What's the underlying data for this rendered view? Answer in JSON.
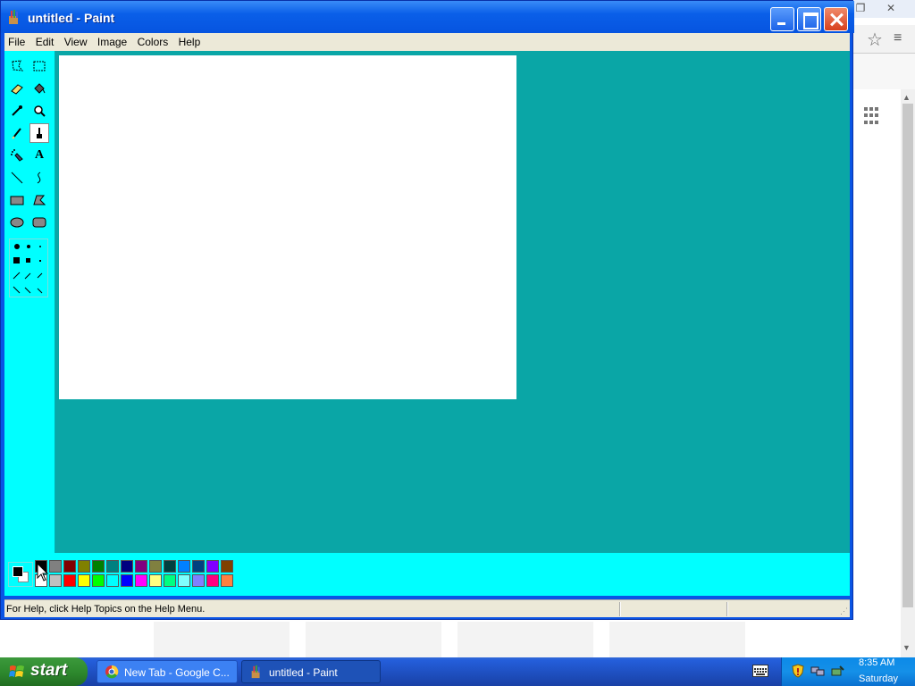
{
  "window": {
    "title": "untitled - Paint"
  },
  "menu": [
    "File",
    "Edit",
    "View",
    "Image",
    "Colors",
    "Help"
  ],
  "tools": [
    "free-form-select",
    "select",
    "eraser",
    "fill-with-color",
    "pick-color",
    "magnifier",
    "pencil",
    "brush",
    "airbrush",
    "text",
    "line",
    "curve",
    "rectangle",
    "polygon",
    "ellipse",
    "rounded-rectangle"
  ],
  "text_tool_glyph": "A",
  "palette": {
    "top": [
      "#000000",
      "#808080",
      "#800000",
      "#808000",
      "#008000",
      "#008080",
      "#000080",
      "#800080",
      "#808040",
      "#004040",
      "#0080ff",
      "#004080",
      "#8000ff",
      "#804000"
    ],
    "bottom": [
      "#ffffff",
      "#c0c0c0",
      "#ff0000",
      "#ffff00",
      "#00ff00",
      "#00ffff",
      "#0000ff",
      "#ff00ff",
      "#ffff80",
      "#00ff80",
      "#80ffff",
      "#8080ff",
      "#ff0080",
      "#ff8040"
    ],
    "foreground": "#000000",
    "background": "#ffffff"
  },
  "status": {
    "text": "For Help, click Help Topics on the Help Menu."
  },
  "taskbar": {
    "start_label": "start",
    "tasks": [
      {
        "label": "New Tab - Google C..."
      },
      {
        "label": "untitled - Paint"
      }
    ],
    "clock_time": "8:35 AM",
    "clock_day": "Saturday"
  },
  "colors": {
    "workspace": "#0aa6a6",
    "toolbox": "#00ffff",
    "titlebar": "#0a5fe8"
  }
}
